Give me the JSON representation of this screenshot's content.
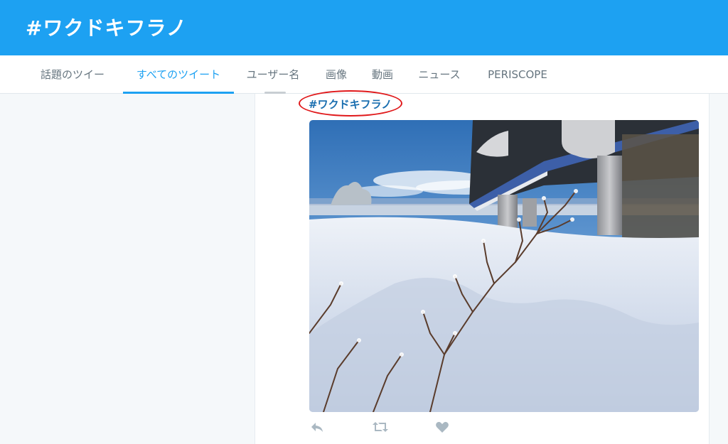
{
  "header": {
    "title": "#ワクドキフラノ"
  },
  "tabs": [
    {
      "label": "話題のツイート",
      "active": false
    },
    {
      "label": "すべてのツイート",
      "active": true
    },
    {
      "label": "ユーザー名",
      "active": false
    },
    {
      "label": "画像",
      "active": false
    },
    {
      "label": "動画",
      "active": false
    },
    {
      "label": "ニュース",
      "active": false
    },
    {
      "label": "PERISCOPE",
      "active": false
    }
  ],
  "tweet": {
    "hashtag": "#ワクドキフラノ",
    "actions": {
      "reply_icon": "reply-icon",
      "retweet_icon": "retweet-icon",
      "like_icon": "heart-icon"
    }
  },
  "colors": {
    "brand": "#1da1f2",
    "hashtag": "#1b6fb0",
    "highlight": "#e0191b",
    "tab_inactive": "#66757f"
  }
}
